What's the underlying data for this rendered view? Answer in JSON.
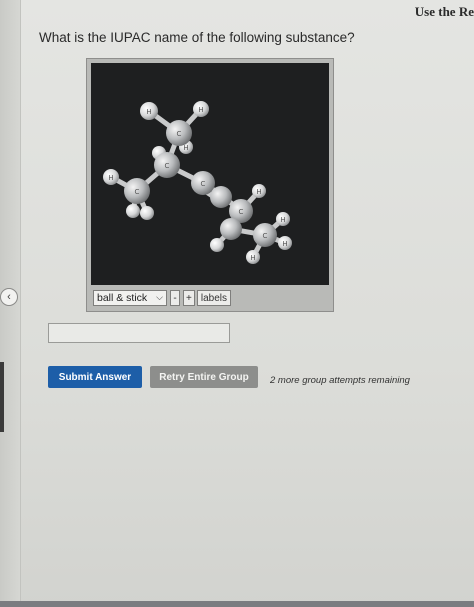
{
  "header": {
    "top_right_text": "Use the Re"
  },
  "question": {
    "text": "What is the IUPAC name of the following substance?"
  },
  "viewer": {
    "mode_selected": "ball & stick",
    "minus_label": "-",
    "plus_label": "+",
    "labels_label": "labels",
    "atom_labels": {
      "carbon": "C",
      "hydrogen": "H"
    }
  },
  "answer": {
    "value": "",
    "placeholder": ""
  },
  "actions": {
    "submit_label": "Submit Answer",
    "retry_label": "Retry Entire Group",
    "attempts_text": "2 more group attempts remaining"
  },
  "colors": {
    "submit_bg": "#1d5ea8",
    "retry_bg": "#8d8e8c",
    "viewer_bg": "#1e1f20"
  }
}
